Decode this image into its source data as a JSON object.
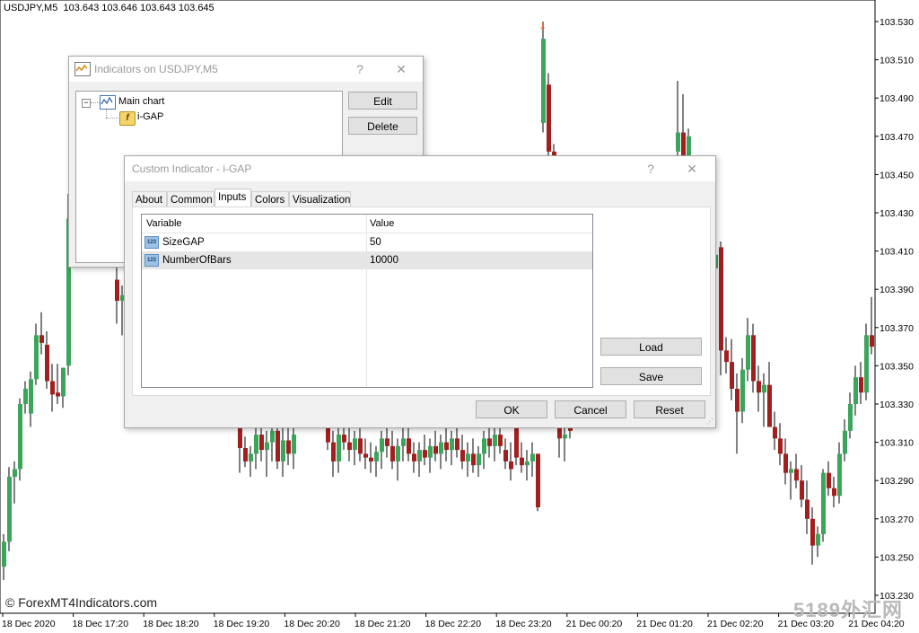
{
  "chart": {
    "symbol": "USDJPY,M5",
    "ohlc": "103.643 103.646 103.643 103.645",
    "price_labels": [
      "103.530",
      "103.510",
      "103.490",
      "103.470",
      "103.450",
      "103.430",
      "103.410",
      "103.390",
      "103.370",
      "103.350",
      "103.330",
      "103.310",
      "103.290",
      "103.270",
      "103.250",
      "103.230"
    ],
    "time_labels": [
      "18 Dec 2020",
      "18 Dec 17:20",
      "18 Dec 18:20",
      "18 Dec 19:20",
      "18 Dec 20:20",
      "18 Dec 21:20",
      "18 Dec 22:20",
      "18 Dec 23:20",
      "21 Dec 00:20",
      "21 Dec 01:20",
      "21 Dec 02:20",
      "21 Dec 03:20",
      "21 Dec 04:20"
    ],
    "up_color": "#3ba55c",
    "down_color": "#a31f1f",
    "watermark_left": "© ForexMT4Indicators.com",
    "watermark_right": "5189外汇网"
  },
  "indicators_window": {
    "title": "Indicators on USDJPY,M5",
    "help": "?",
    "close": "✕",
    "tree_root": "Main chart",
    "tree_child": "i-GAP",
    "edit_label": "Edit",
    "delete_label": "Delete"
  },
  "custom_window": {
    "title": "Custom Indicator - i-GAP",
    "help": "?",
    "close": "✕",
    "tabs": [
      "About",
      "Common",
      "Inputs",
      "Colors",
      "Visualization"
    ],
    "active_tab": "Inputs",
    "col_variable": "Variable",
    "col_value": "Value",
    "rows": [
      {
        "icon": "123",
        "name": "SizeGAP",
        "value": "50"
      },
      {
        "icon": "123",
        "name": "NumberOfBars",
        "value": "10000"
      }
    ],
    "load_label": "Load",
    "save_label": "Save",
    "ok_label": "OK",
    "cancel_label": "Cancel",
    "reset_label": "Reset"
  }
}
